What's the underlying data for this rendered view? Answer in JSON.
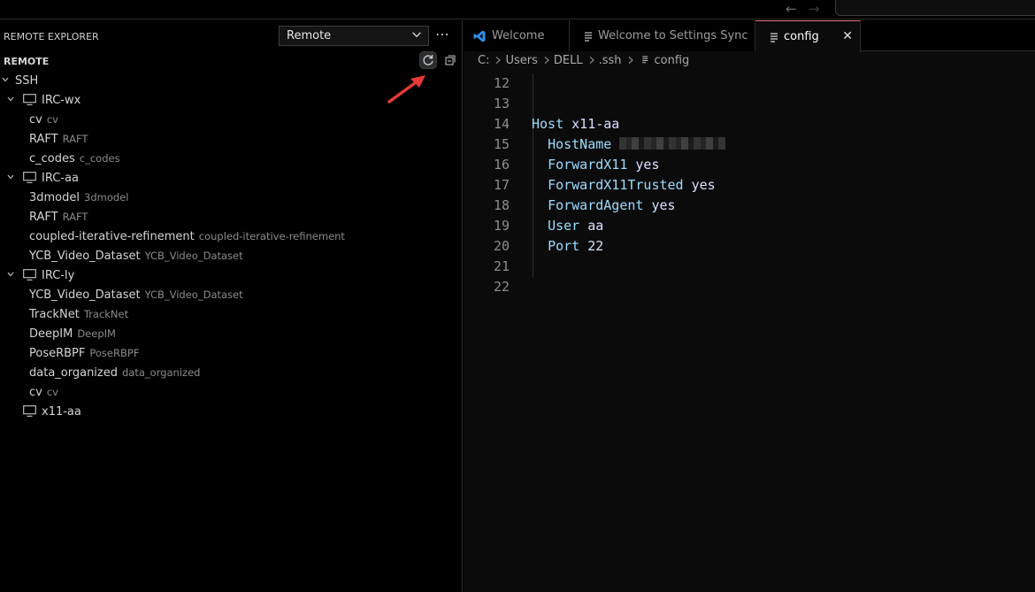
{
  "titlebar": {
    "back_icon": "arrow-left-icon",
    "forward_icon": "arrow-right-icon"
  },
  "sidebar": {
    "title": "REMOTE EXPLORER",
    "dropdown_value": "Remote",
    "section_title": "REMOTE",
    "tree": [
      {
        "label": "SSH",
        "description": "",
        "indent": 0,
        "twisty": "open",
        "icon": false
      },
      {
        "label": "IRC-wx",
        "description": "",
        "indent": 1,
        "twisty": "open",
        "icon": true
      },
      {
        "label": "cv",
        "description": "cv",
        "indent": 2,
        "twisty": "none",
        "icon": false
      },
      {
        "label": "RAFT",
        "description": "RAFT",
        "indent": 2,
        "twisty": "none",
        "icon": false
      },
      {
        "label": "c_codes",
        "description": "c_codes",
        "indent": 2,
        "twisty": "none",
        "icon": false
      },
      {
        "label": "IRC-aa",
        "description": "",
        "indent": 1,
        "twisty": "open",
        "icon": true
      },
      {
        "label": "3dmodel",
        "description": "3dmodel",
        "indent": 2,
        "twisty": "none",
        "icon": false
      },
      {
        "label": "RAFT",
        "description": "RAFT",
        "indent": 2,
        "twisty": "none",
        "icon": false
      },
      {
        "label": "coupled-iterative-refinement",
        "description": "coupled-iterative-refinement",
        "indent": 2,
        "twisty": "none",
        "icon": false
      },
      {
        "label": "YCB_Video_Dataset",
        "description": "YCB_Video_Dataset",
        "indent": 2,
        "twisty": "none",
        "icon": false
      },
      {
        "label": "IRC-ly",
        "description": "",
        "indent": 1,
        "twisty": "open",
        "icon": true
      },
      {
        "label": "YCB_Video_Dataset",
        "description": "YCB_Video_Dataset",
        "indent": 2,
        "twisty": "none",
        "icon": false
      },
      {
        "label": "TrackNet",
        "description": "TrackNet",
        "indent": 2,
        "twisty": "none",
        "icon": false
      },
      {
        "label": "DeepIM",
        "description": "DeepIM",
        "indent": 2,
        "twisty": "none",
        "icon": false
      },
      {
        "label": "PoseRBPF",
        "description": "PoseRBPF",
        "indent": 2,
        "twisty": "none",
        "icon": false
      },
      {
        "label": "data_organized",
        "description": "data_organized",
        "indent": 2,
        "twisty": "none",
        "icon": false
      },
      {
        "label": "cv",
        "description": "cv",
        "indent": 2,
        "twisty": "none",
        "icon": false
      },
      {
        "label": "x11-aa",
        "description": "",
        "indent": 1,
        "twisty": "none",
        "icon": true
      }
    ]
  },
  "editor": {
    "tabs": [
      {
        "label": "Welcome",
        "icon": "vscode-logo-icon",
        "active": false
      },
      {
        "label": "Welcome to Settings Sync",
        "icon": "file-lines-icon",
        "active": false
      },
      {
        "label": "config",
        "icon": "file-lines-icon",
        "active": true
      }
    ],
    "breadcrumb": [
      "C:",
      "Users",
      "DELL",
      ".ssh",
      "config"
    ],
    "lines": [
      {
        "num": "12",
        "key": "",
        "value": ""
      },
      {
        "num": "13",
        "key": "",
        "value": ""
      },
      {
        "num": "14",
        "key": "Host",
        "value": "x11-aa",
        "indent": false
      },
      {
        "num": "15",
        "key": "HostName",
        "value": "",
        "indent": true,
        "blurred": true
      },
      {
        "num": "16",
        "key": "ForwardX11",
        "value": "yes",
        "indent": true
      },
      {
        "num": "17",
        "key": "ForwardX11Trusted",
        "value": "yes",
        "indent": true
      },
      {
        "num": "18",
        "key": "ForwardAgent",
        "value": "yes",
        "indent": true
      },
      {
        "num": "19",
        "key": "User",
        "value": "aa",
        "indent": true
      },
      {
        "num": "20",
        "key": "Port",
        "value": "22",
        "indent": true
      },
      {
        "num": "21",
        "key": "",
        "value": ""
      },
      {
        "num": "22",
        "key": "",
        "value": ""
      }
    ]
  },
  "colors": {
    "accent_tab_border": "#e5767f",
    "code_key": "#9cdcfe",
    "annotation_arrow": "#e53935"
  }
}
